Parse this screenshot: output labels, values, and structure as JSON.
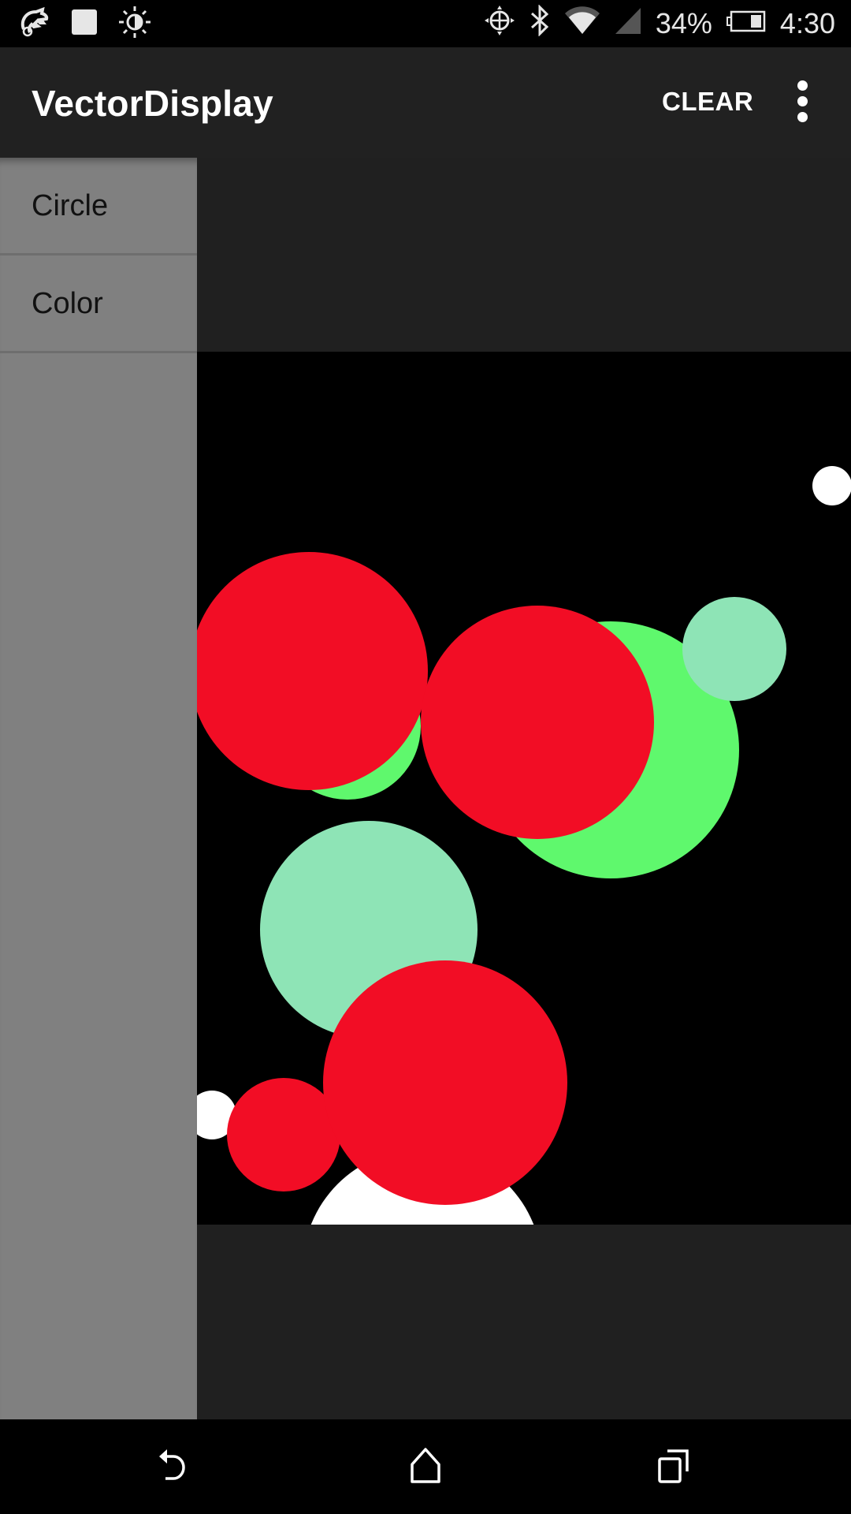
{
  "status_bar": {
    "left_icons": [
      "chameleon-app-icon",
      "square-notification-icon",
      "brightness-icon"
    ],
    "right_icons": [
      "gps-icon",
      "bluetooth-icon",
      "wifi-icon",
      "cell-signal-icon"
    ],
    "battery_percent": "34%",
    "battery_level": 0.34,
    "time": "4:30"
  },
  "toolbar": {
    "title": "VectorDisplay",
    "clear_label": "CLEAR",
    "overflow_icon": "more-vert-icon"
  },
  "drawer": {
    "items": [
      {
        "label": "Circle"
      },
      {
        "label": "Color"
      }
    ]
  },
  "canvas": {
    "background": "#000000",
    "shapes": [
      {
        "type": "circle",
        "color": "#ffffff"
      },
      {
        "type": "circle",
        "color": "#8ee4b6"
      },
      {
        "type": "circle",
        "color": "#5ff86d"
      },
      {
        "type": "circle",
        "color": "#f20d25"
      },
      {
        "type": "circle",
        "color": "#ffffff"
      },
      {
        "type": "circle",
        "color": "#5ff86d"
      },
      {
        "type": "circle",
        "color": "#8ee4b6"
      },
      {
        "type": "circle",
        "color": "#f20d25"
      },
      {
        "type": "circle",
        "color": "#ffffff"
      },
      {
        "type": "circle",
        "color": "#f20d25"
      },
      {
        "type": "circle",
        "color": "#f20d25"
      }
    ]
  },
  "nav_bar": {
    "icons": [
      "back-icon",
      "home-icon",
      "recents-icon"
    ]
  }
}
